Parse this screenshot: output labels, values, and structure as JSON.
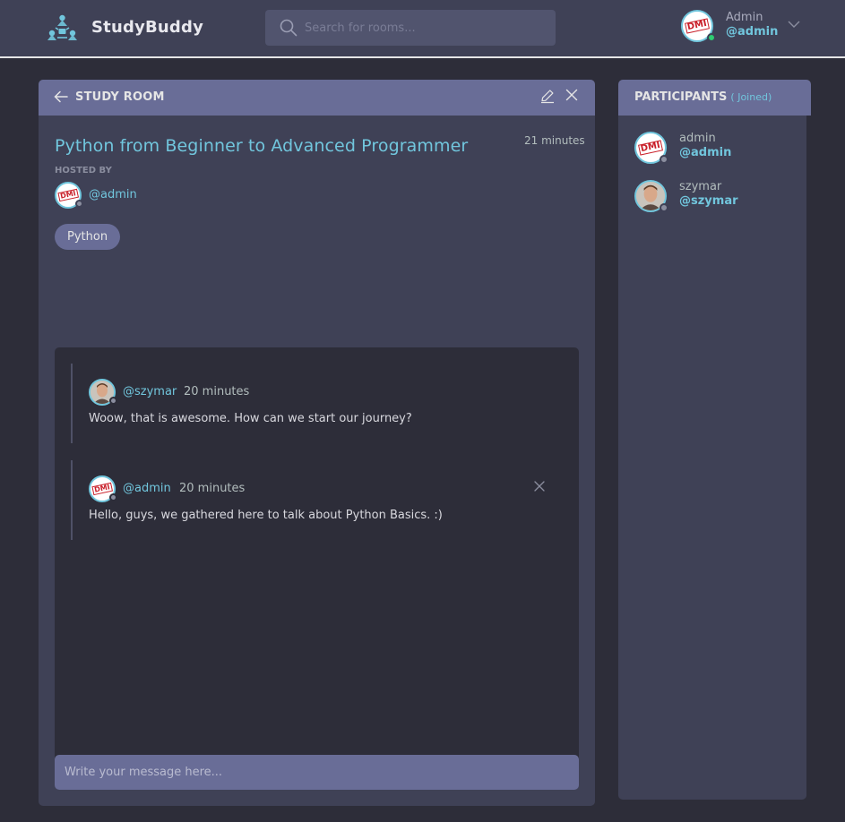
{
  "header": {
    "brand": "StudyBuddy",
    "search": {
      "placeholder": "Search for rooms..."
    },
    "user": {
      "name": "Admin",
      "handle": "@admin",
      "status": "online"
    }
  },
  "room": {
    "header_title": "STUDY ROOM",
    "title": "Python from Beginner to Advanced Programmer",
    "time": "21 minutes",
    "hosted_by_label": "HOSTED BY",
    "host": {
      "handle": "@admin"
    },
    "topic": "Python",
    "messages": [
      {
        "author": "@szymar",
        "time": "20 minutes",
        "body": "Woow, that is awesome. How can we start our journey?"
      },
      {
        "author": "@admin",
        "time": "20 minutes",
        "body": "Hello, guys, we gathered here to talk about Python Basics. :)"
      }
    ],
    "composer": {
      "placeholder": "Write your message here..."
    }
  },
  "participants": {
    "title": "PARTICIPANTS",
    "joined": "( Joined)",
    "list": [
      {
        "name": "admin",
        "handle": "@admin"
      },
      {
        "name": "szymar",
        "handle": "@szymar"
      }
    ]
  },
  "stamp_text": "DMI",
  "colors": {
    "background": "#2d2d39",
    "panel": "#3f4156",
    "panel_header": "#696d97",
    "accent": "#71c6dd",
    "online": "#2ecc71",
    "offline": "#8b8e9f"
  }
}
